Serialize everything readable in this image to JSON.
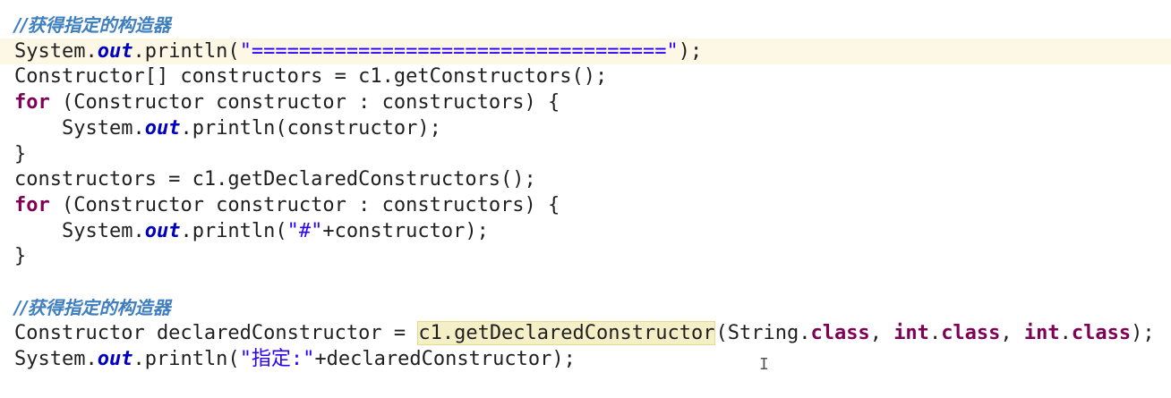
{
  "lines": [
    {
      "tokens": [
        {
          "t": "//获得指定的构造器",
          "c": "comment"
        }
      ]
    },
    {
      "current": true,
      "tokens": [
        {
          "t": "System."
        },
        {
          "t": "out",
          "c": "field"
        },
        {
          "t": ".println("
        },
        {
          "t": "\"===================================\"",
          "c": "string"
        },
        {
          "t": ");"
        }
      ]
    },
    {
      "tokens": [
        {
          "t": "Constructor[] constructors = c1.getConstructors();"
        }
      ]
    },
    {
      "tokens": [
        {
          "t": "for",
          "c": "keyword"
        },
        {
          "t": " (Constructor constructor : constructors) {"
        }
      ]
    },
    {
      "tokens": [
        {
          "t": "    System."
        },
        {
          "t": "out",
          "c": "field"
        },
        {
          "t": ".println(constructor);"
        }
      ]
    },
    {
      "tokens": [
        {
          "t": "}"
        }
      ]
    },
    {
      "tokens": [
        {
          "t": "constructors = c1.getDeclaredConstructors();"
        }
      ]
    },
    {
      "tokens": [
        {
          "t": "for",
          "c": "keyword"
        },
        {
          "t": " (Constructor constructor : constructors) {"
        }
      ]
    },
    {
      "tokens": [
        {
          "t": "    System."
        },
        {
          "t": "out",
          "c": "field"
        },
        {
          "t": ".println("
        },
        {
          "t": "\"#\"",
          "c": "string"
        },
        {
          "t": "+constructor);"
        }
      ]
    },
    {
      "tokens": [
        {
          "t": "}"
        }
      ]
    },
    {
      "tokens": []
    },
    {
      "tokens": [
        {
          "t": "//获得指定的构造器",
          "c": "comment"
        }
      ]
    },
    {
      "tokens": [
        {
          "t": "Constructor declaredConstructor = "
        },
        {
          "t": "c1.getDeclaredConstructor",
          "c": "highlight"
        },
        {
          "t": "(String."
        },
        {
          "t": "class",
          "c": "keyword"
        },
        {
          "t": ", "
        },
        {
          "t": "int",
          "c": "keyword"
        },
        {
          "t": "."
        },
        {
          "t": "class",
          "c": "keyword"
        },
        {
          "t": ", "
        },
        {
          "t": "int",
          "c": "keyword"
        },
        {
          "t": "."
        },
        {
          "t": "class",
          "c": "keyword"
        },
        {
          "t": ");"
        }
      ]
    },
    {
      "tokens": [
        {
          "t": "System."
        },
        {
          "t": "out",
          "c": "field"
        },
        {
          "t": ".println("
        },
        {
          "t": "\"指定:\"",
          "c": "string"
        },
        {
          "t": "+declaredConstructor);"
        }
      ]
    }
  ],
  "cursor_glyph": "I",
  "colors": {
    "comment": "#3f7fbf",
    "keyword": "#7f0055",
    "field": "#0000c0",
    "string": "#2a00ff",
    "current_line": "#fdf8e6",
    "highlight": "#f5efc8"
  }
}
